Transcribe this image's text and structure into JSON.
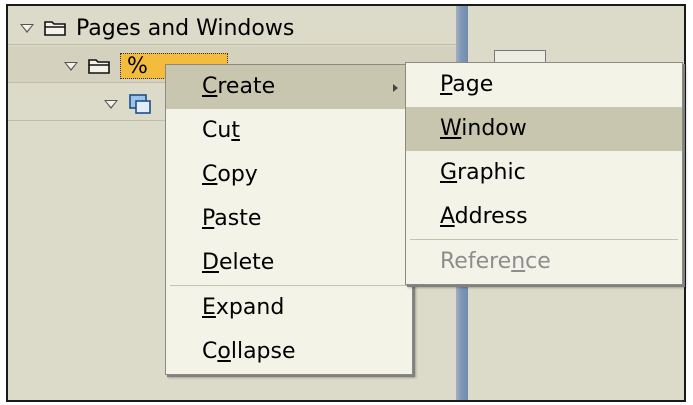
{
  "tree": {
    "root_label": "Pages and Windows",
    "selected_node_label": "%"
  },
  "context_menu": {
    "items": [
      {
        "label": "Create",
        "mnemonic": "C",
        "rest": "reate",
        "prefix": ""
      },
      {
        "label": "Cut",
        "mnemonic": "t",
        "rest": "",
        "prefix": "Cu"
      },
      {
        "label": "Copy",
        "mnemonic": "C",
        "rest": "opy",
        "prefix": ""
      },
      {
        "label": "Paste",
        "mnemonic": "P",
        "rest": "aste",
        "prefix": ""
      },
      {
        "label": "Delete",
        "mnemonic": "D",
        "rest": "elete",
        "prefix": ""
      },
      {
        "label": "Expand",
        "mnemonic": "E",
        "rest": "xpand",
        "prefix": ""
      },
      {
        "label": "Collapse",
        "mnemonic": "o",
        "rest": "llapse",
        "prefix": "C"
      }
    ]
  },
  "create_submenu": {
    "items": [
      {
        "label": "Page",
        "mnemonic": "P",
        "rest": "age",
        "prefix": ""
      },
      {
        "label": "Window",
        "mnemonic": "W",
        "rest": "indow",
        "prefix": ""
      },
      {
        "label": "Graphic",
        "mnemonic": "G",
        "rest": "raphic",
        "prefix": ""
      },
      {
        "label": "Address",
        "mnemonic": "A",
        "rest": "ddress",
        "prefix": ""
      },
      {
        "label": "Reference",
        "mnemonic": "n",
        "rest": "ce",
        "prefix": "Refere"
      }
    ],
    "highlighted": "Window",
    "disabled": "Reference"
  },
  "colors": {
    "background": "#dcdac9",
    "menu_background": "#f4f3e8",
    "highlight": "#c9c6b0",
    "selected_node": "#f3bc3c",
    "splitter": "#7f97b4"
  }
}
